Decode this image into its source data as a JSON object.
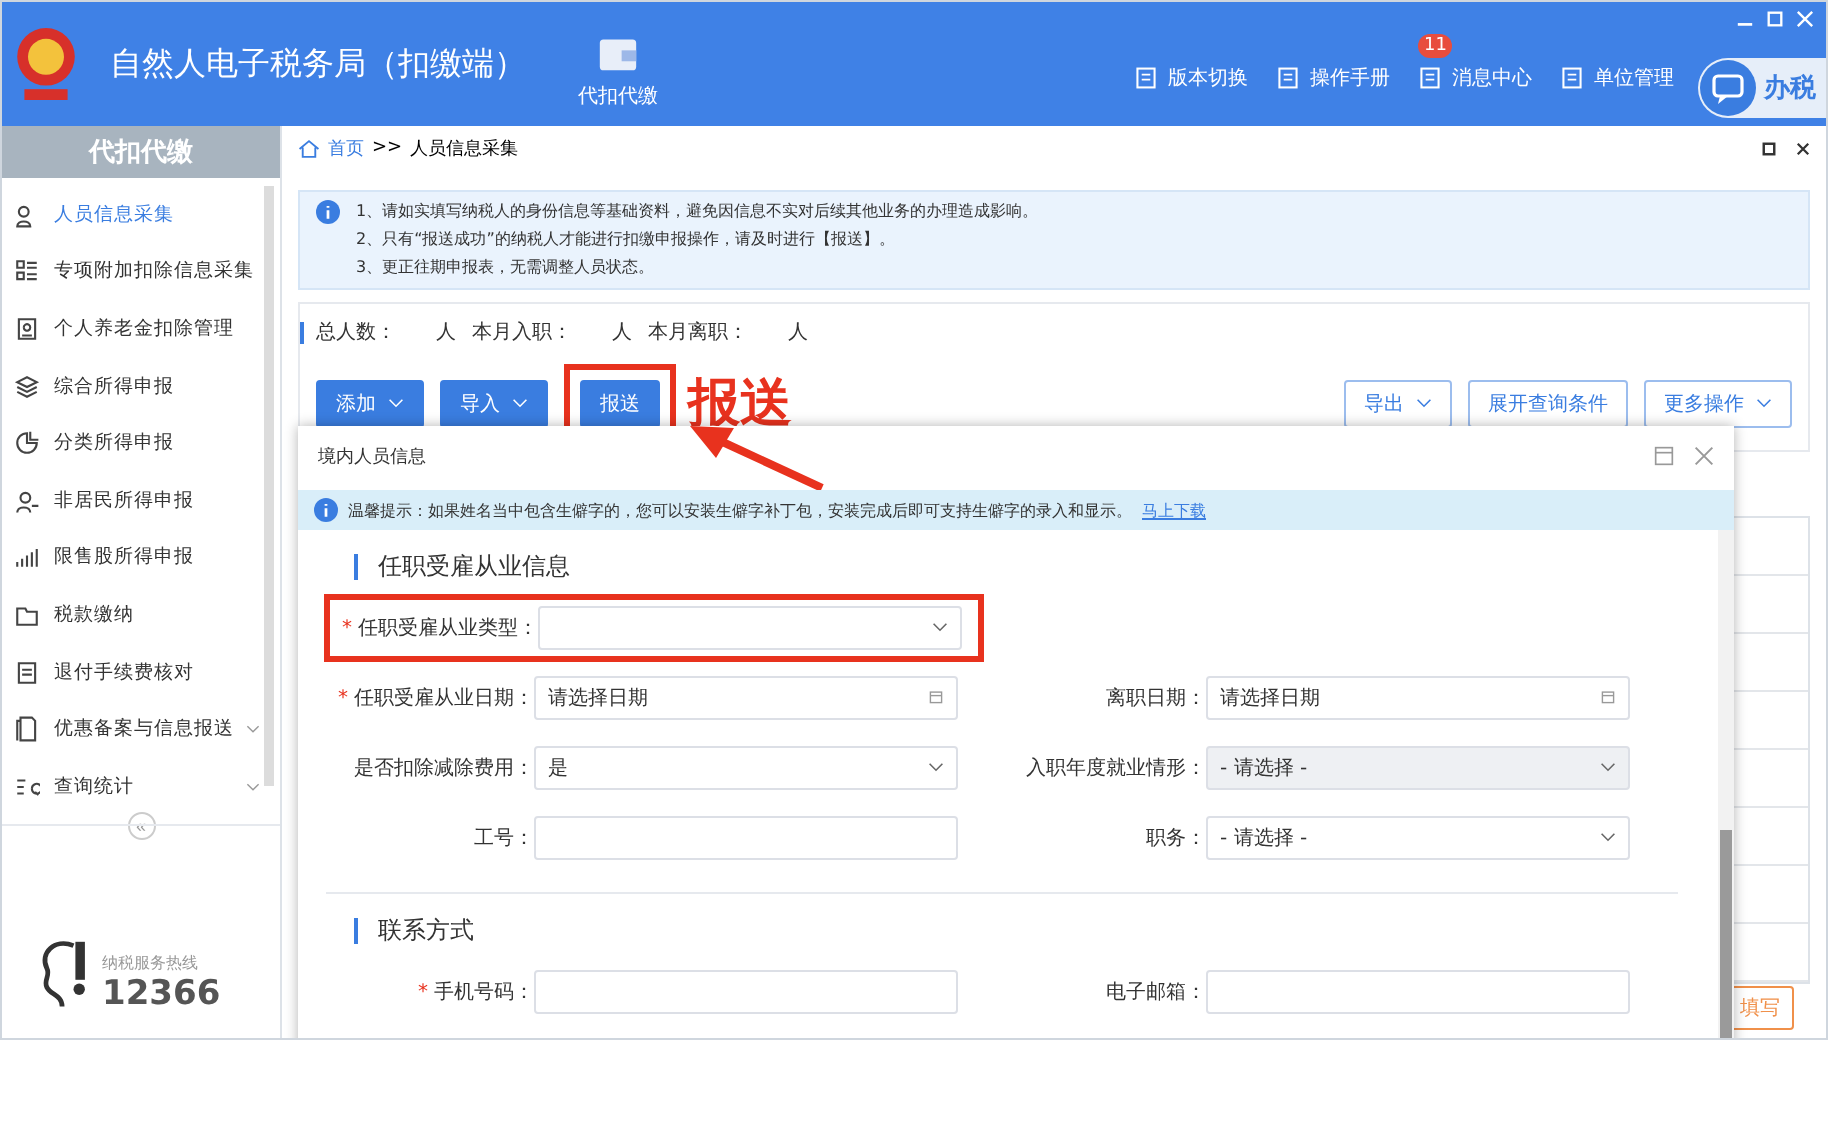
{
  "header": {
    "title": "自然人电子税务局（扣缴端）",
    "center_tab": "代扣代缴",
    "nav": [
      {
        "label": "版本切换"
      },
      {
        "label": "操作手册"
      },
      {
        "label": "消息中心",
        "badge": "11"
      },
      {
        "label": "单位管理"
      }
    ],
    "chat_label": "办税"
  },
  "sidebar": {
    "title": "代扣代缴",
    "items": [
      {
        "label": "人员信息采集",
        "selected": true,
        "expandable": false
      },
      {
        "label": "专项附加扣除信息采集",
        "selected": false,
        "expandable": false
      },
      {
        "label": "个人养老金扣除管理",
        "selected": false,
        "expandable": false
      },
      {
        "label": "综合所得申报",
        "selected": false,
        "expandable": false
      },
      {
        "label": "分类所得申报",
        "selected": false,
        "expandable": false
      },
      {
        "label": "非居民所得申报",
        "selected": false,
        "expandable": false
      },
      {
        "label": "限售股所得申报",
        "selected": false,
        "expandable": false
      },
      {
        "label": "税款缴纳",
        "selected": false,
        "expandable": false
      },
      {
        "label": "退付手续费核对",
        "selected": false,
        "expandable": false
      },
      {
        "label": "优惠备案与信息报送",
        "selected": false,
        "expandable": true
      },
      {
        "label": "查询统计",
        "selected": false,
        "expandable": true
      }
    ],
    "collapse": "«",
    "hotline": {
      "label": "纳税服务热线",
      "number": "12366"
    }
  },
  "breadcrumb": {
    "home": "首页",
    "separator": ">>",
    "current": "人员信息采集"
  },
  "notice": [
    "1、请如实填写纳税人的身份信息等基础资料，避免因信息不实对后续其他业务的办理造成影响。",
    "2、只有“报送成功”的纳税人才能进行扣缴申报操作，请及时进行【报送】。",
    "3、更正往期申报表，无需调整人员状态。"
  ],
  "stats": [
    {
      "label": "总人数：",
      "unit": "人"
    },
    {
      "label": "本月入职：",
      "unit": "人"
    },
    {
      "label": "本月离职：",
      "unit": "人"
    }
  ],
  "toolbar": {
    "left": [
      {
        "label": "添加",
        "kind": "primary",
        "dropdown": true,
        "annotated": false
      },
      {
        "label": "导入",
        "kind": "primary",
        "dropdown": true,
        "annotated": false
      },
      {
        "label": "报送",
        "kind": "primary",
        "dropdown": false,
        "annotated": true
      }
    ],
    "right": [
      {
        "label": "导出",
        "kind": "outline",
        "dropdown": true,
        "annotated": false
      },
      {
        "label": "展开查询条件",
        "kind": "outline",
        "dropdown": false,
        "annotated": false
      },
      {
        "label": "更多操作",
        "kind": "outline",
        "dropdown": true,
        "annotated": false
      }
    ]
  },
  "annotation": {
    "label": "报送"
  },
  "side_button": "填写",
  "dialog": {
    "title": "境内人员信息",
    "required_mark": "*",
    "tip": "温馨提示：如果姓名当中包含生僻字的，您可以安装生僻字补丁包，安装完成后即可支持生僻字的录入和显示。",
    "tip_link": "马上下载",
    "sections": [
      {
        "title": "任职受雇从业信息",
        "rows": [
          [
            {
              "label": "任职受雇从业类型：",
              "kind": "select",
              "required": true,
              "disabled": false,
              "annotated": true
            }
          ],
          [
            {
              "label": "任职受雇从业日期：",
              "kind": "date",
              "placeholder": "请选择日期",
              "required": true,
              "disabled": false,
              "annotated": false
            },
            {
              "label": "离职日期：",
              "kind": "date",
              "placeholder": "请选择日期",
              "required": false,
              "disabled": false,
              "annotated": false
            }
          ],
          [
            {
              "label": "是否扣除减除费用：",
              "kind": "select",
              "value": "是",
              "required": false,
              "disabled": false,
              "annotated": false
            },
            {
              "label": "入职年度就业情形：",
              "kind": "select",
              "value": "- 请选择 -",
              "required": false,
              "disabled": true,
              "annotated": false
            }
          ],
          [
            {
              "label": "工号：",
              "kind": "text",
              "required": false,
              "disabled": false,
              "annotated": false
            },
            {
              "label": "职务：",
              "kind": "select",
              "value": "- 请选择 -",
              "required": false,
              "disabled": false,
              "annotated": false
            }
          ]
        ]
      },
      {
        "title": "联系方式",
        "rows": [
          [
            {
              "label": "手机号码：",
              "kind": "text",
              "required": true,
              "disabled": false,
              "annotated": false
            },
            {
              "label": "电子邮箱：",
              "kind": "text",
              "required": false,
              "disabled": false,
              "annotated": false
            }
          ]
        ]
      }
    ]
  }
}
